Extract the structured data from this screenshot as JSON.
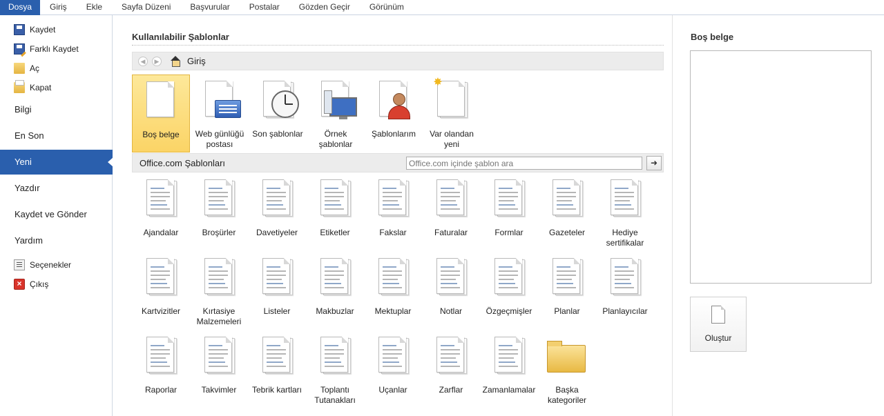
{
  "ribbon": {
    "tabs": [
      "Dosya",
      "Giriş",
      "Ekle",
      "Sayfa Düzeni",
      "Başvurular",
      "Postalar",
      "Gözden Geçir",
      "Görünüm"
    ]
  },
  "nav": {
    "commands": [
      {
        "label": "Kaydet",
        "icon": "save-icon"
      },
      {
        "label": "Farklı Kaydet",
        "icon": "save-as-icon"
      },
      {
        "label": "Aç",
        "icon": "open-folder-icon"
      },
      {
        "label": "Kapat",
        "icon": "close-folder-icon"
      }
    ],
    "tabs": [
      "Bilgi",
      "En Son",
      "Yeni",
      "Yazdır",
      "Kaydet ve Gönder",
      "Yardım"
    ],
    "active_tab": "Yeni",
    "bottom": [
      {
        "label": "Seçenekler",
        "icon": "options-icon"
      },
      {
        "label": "Çıkış",
        "icon": "exit-icon"
      }
    ]
  },
  "main": {
    "section_title": "Kullanılabilir Şablonlar",
    "breadcrumb": "Giriş",
    "available": [
      {
        "label": "Boş belge",
        "selected": true
      },
      {
        "label": "Web günlüğü postası"
      },
      {
        "label": "Son şablonlar"
      },
      {
        "label": "Örnek şablonlar"
      },
      {
        "label": "Şablonlarım"
      },
      {
        "label": "Var olandan yeni"
      }
    ],
    "office_title": "Office.com Şablonları",
    "search_placeholder": "Office.com içinde şablon ara",
    "search_go": "➜",
    "categories": [
      "Ajandalar",
      "Broşürler",
      "Davetiyeler",
      "Etiketler",
      "Fakslar",
      "Faturalar",
      "Formlar",
      "Gazeteler",
      "Hediye sertifikalar",
      "Kartvizitler",
      "Kırtasiye Malzemeleri",
      "Listeler",
      "Makbuzlar",
      "Mektuplar",
      "Notlar",
      "Özgeçmişler",
      "Planlar",
      "Planlayıcılar",
      "Raporlar",
      "Takvimler",
      "Tebrik kartları",
      "Toplantı Tutanakları",
      "Uçanlar",
      "Zarflar",
      "Zamanlamalar",
      "Başka kategoriler"
    ]
  },
  "preview": {
    "title": "Boş belge",
    "create_label": "Oluştur"
  },
  "colors": {
    "accent": "#2a5fad",
    "selection": "#fbd466"
  }
}
